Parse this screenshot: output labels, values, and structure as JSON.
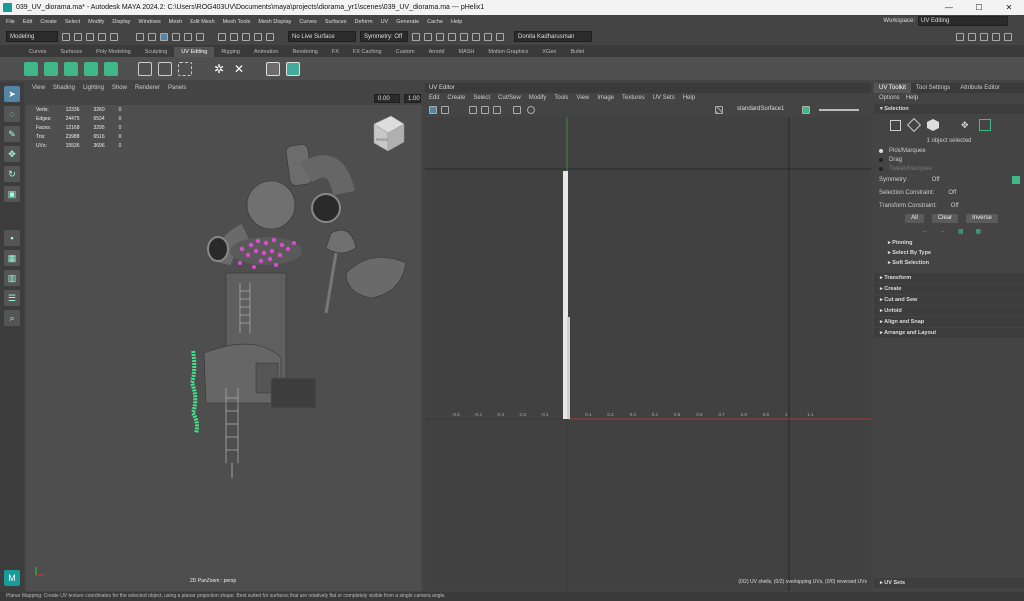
{
  "titlebar": {
    "title": "039_UV_diorama.ma* - Autodesk MAYA 2024.2: C:\\Users\\ROG403UV\\Documents\\maya\\projects\\diorama_yr1\\scenes\\039_UV_diorama.ma   ---   pHelix1"
  },
  "menubar": {
    "items": [
      "File",
      "Edit",
      "Create",
      "Select",
      "Modify",
      "Display",
      "Windows",
      "Mesh",
      "Edit Mesh",
      "Mesh Tools",
      "Mesh Display",
      "Curves",
      "Surfaces",
      "Deform",
      "UV",
      "Generate",
      "Cache",
      "Help"
    ],
    "workspace_label": "Workspace:",
    "workspace_value": "UV Editing"
  },
  "statusline": {
    "mode": "Modeling",
    "live_surface": "No Live Surface",
    "symmetry": "Symmetry: Off",
    "user": "Donita Kadharusman"
  },
  "shelf_tabs": [
    "Curves",
    "Surfaces",
    "Poly Modeling",
    "Sculpting",
    "UV Editing",
    "Rigging",
    "Animation",
    "Rendering",
    "FX",
    "FX Caching",
    "Custom",
    "Arnold",
    "MASH",
    "Motion Graphics",
    "XGen",
    "Bullet"
  ],
  "shelf_active": "UV Editing",
  "viewport": {
    "menu": [
      "View",
      "Shading",
      "Lighting",
      "Show",
      "Renderer",
      "Panels"
    ],
    "val1": "0.00",
    "val2": "1.00",
    "hud": [
      {
        "label": "Verts:",
        "a": "12336",
        "b": "3260",
        "c": "0"
      },
      {
        "label": "Edges:",
        "a": "24475",
        "b": "6534",
        "c": "0"
      },
      {
        "label": "Faces:",
        "a": "12168",
        "b": "3295",
        "c": "0"
      },
      {
        "label": "Tris:",
        "a": "23988",
        "b": "6516",
        "c": "0"
      },
      {
        "label": "UVs:",
        "a": "15536",
        "b": "3696",
        "c": "0"
      }
    ],
    "camera_label": "2D PanZoom : persp",
    "cube_label": "FRONT"
  },
  "uv_editor": {
    "header": "UV Editor",
    "menu": [
      "Edit",
      "Create",
      "Select",
      "Cut/Sew",
      "Modify",
      "Tools",
      "View",
      "Image",
      "Textures",
      "UV Sets",
      "Help"
    ],
    "shader": "standardSurface1",
    "x_ticks": [
      "-0.5",
      "-0.4",
      "-0.3",
      "-0.2",
      "-0.1",
      "0.1",
      "0.2",
      "0.3",
      "0.4",
      "0.5",
      "0.6",
      "0.7",
      "0.8",
      "0.9",
      "1",
      "1.1"
    ],
    "status": "(0/2) UV shells, (0/2) overlapping UVs, (0/0) reversed UVs"
  },
  "toolkit": {
    "tabs": [
      "UV Toolkit",
      "Tool Settings",
      "Attribute Editor"
    ],
    "menu": [
      "Options",
      "Help"
    ],
    "selection_header": "Selection",
    "object_selected": "1 object selected",
    "modes": [
      "Pick/Marquee",
      "Drag",
      "Tweak/Marquee"
    ],
    "symmetry_label": "Symmetry:",
    "symmetry_value": "Off",
    "sel_constraint_label": "Selection Constraint:",
    "sel_constraint_value": "Off",
    "trans_constraint_label": "Transform Constraint:",
    "trans_constraint_value": "Off",
    "buttons": [
      "All",
      "Clear",
      "Inverse"
    ],
    "subsections": [
      "Pinning",
      "Select By Type",
      "Soft Selection"
    ],
    "sections": [
      "Transform",
      "Create",
      "Cut and Sew",
      "Unfold",
      "Align and Snap",
      "Arrange and Layout"
    ],
    "bottom_section": "UV Sets"
  },
  "helpline": "Planar Mapping: Create UV texture coordinates for the selected object, using a planar projection shape. Best suited for surfaces that are relatively flat or completely visible from a single camera angle.",
  "colors": {
    "accent": "#5285a6",
    "uv_shell": "#e8e8e8",
    "mesh_green": "#44e08a",
    "points": "#e04ad0"
  }
}
